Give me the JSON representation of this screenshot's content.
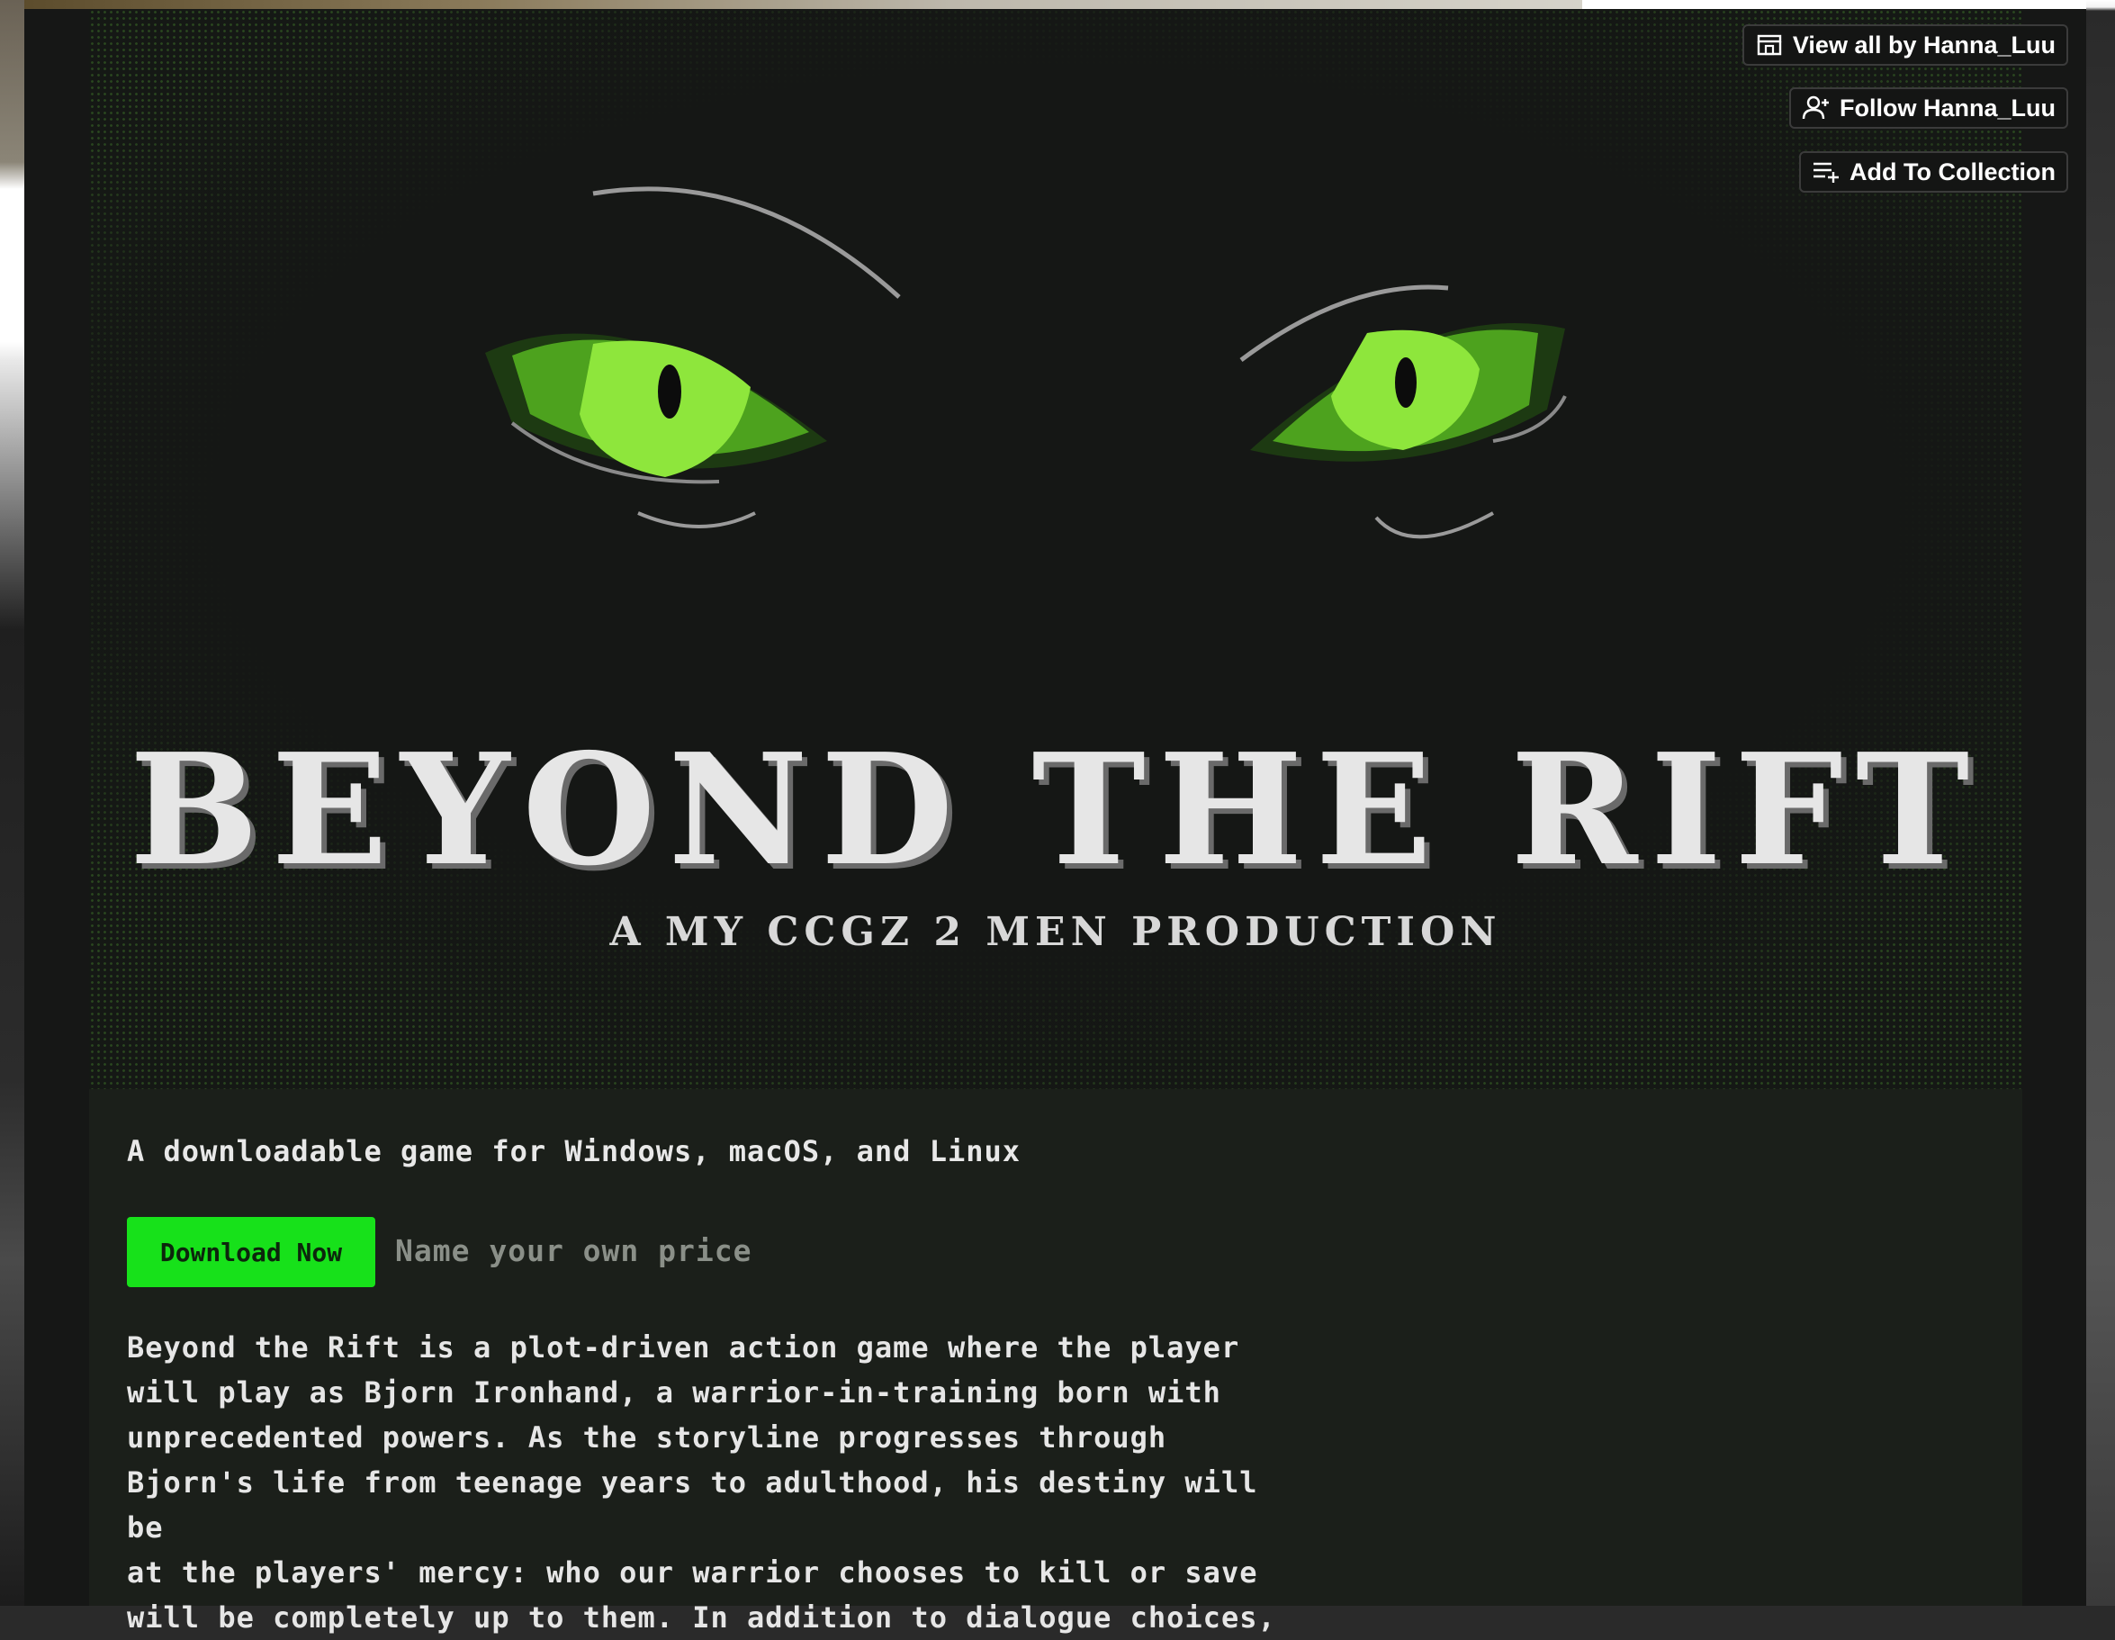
{
  "header": {
    "view_all_label": "View all by Hanna_Luu",
    "follow_label": "Follow Hanna_Luu",
    "add_collection_label": "Add To Collection"
  },
  "banner": {
    "title": "BEYOND THE RIFT",
    "subtitle": "A MY CCGZ 2 MEN PRODUCTION",
    "eye_color": "#8ee63c"
  },
  "content": {
    "platforms": "A downloadable game for Windows, macOS, and Linux",
    "download_label": "Download Now",
    "price_hint": "Name your own price",
    "description": "Beyond the Rift is a plot-driven action game where the player\nwill play as Bjorn Ironhand, a warrior-in-training born with\nunprecedented powers. As the storyline progresses through\nBjorn's life from teenage years to adulthood, his destiny will be\nat the players' mercy: who our warrior chooses to kill or save\nwill be completely up to them. In addition to dialogue choices,"
  },
  "colors": {
    "accent": "#17e11a",
    "page_bg": "#1b1f1a"
  }
}
